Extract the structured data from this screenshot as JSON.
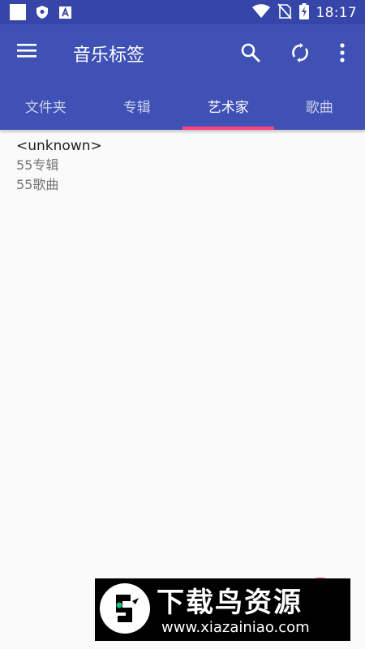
{
  "status_bar": {
    "time": "18:17",
    "notification_icons": [
      "square-notification-icon",
      "shield-notification-icon",
      "a-notification-icon"
    ],
    "system_icons": [
      "wifi-icon",
      "no-sim-icon",
      "battery-charging-icon"
    ]
  },
  "app_bar": {
    "title": "音乐标签",
    "actions": [
      "search-icon",
      "sync-icon",
      "more-vert-icon"
    ]
  },
  "tabs": [
    {
      "label": "文件夹",
      "active": false
    },
    {
      "label": "专辑",
      "active": false
    },
    {
      "label": "艺术家",
      "active": true
    },
    {
      "label": "歌曲",
      "active": false
    }
  ],
  "artists": [
    {
      "name": "<unknown>",
      "albums": "55专辑",
      "songs": "55歌曲"
    }
  ],
  "colors": {
    "primary": "#3f51b5",
    "primary_dark": "#3546a8",
    "accent": "#ff4081",
    "background": "#fafafa"
  },
  "watermark": {
    "title": "下载鸟资源",
    "url": "www.xiazainiao.com"
  }
}
